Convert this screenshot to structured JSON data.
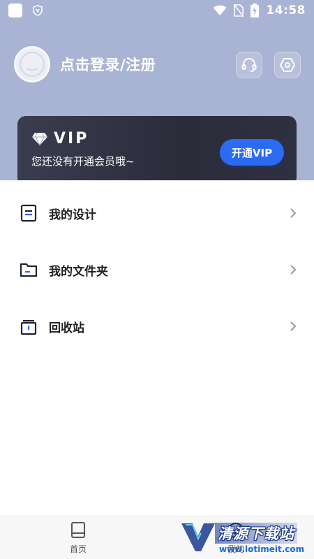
{
  "status_bar": {
    "time": "14:58"
  },
  "profile": {
    "login_text": "点击登录/注册"
  },
  "vip": {
    "label": "VIP",
    "subtitle": "您还没有开通会员哦~",
    "button": "开通VIP"
  },
  "menu": [
    {
      "label": "我的设计",
      "icon": "design-doc-icon"
    },
    {
      "label": "我的文件夹",
      "icon": "folder-icon"
    },
    {
      "label": "回收站",
      "icon": "trash-icon"
    }
  ],
  "bottom_nav": {
    "home_label": "首页",
    "mine_label": "我的"
  },
  "watermark": {
    "title": "清源下载站",
    "url": "www.lotimeit.com"
  },
  "colors": {
    "header_bg": "#a9b3d3",
    "vip_card": "#2e3040",
    "vip_button": "#2a6bf2"
  }
}
